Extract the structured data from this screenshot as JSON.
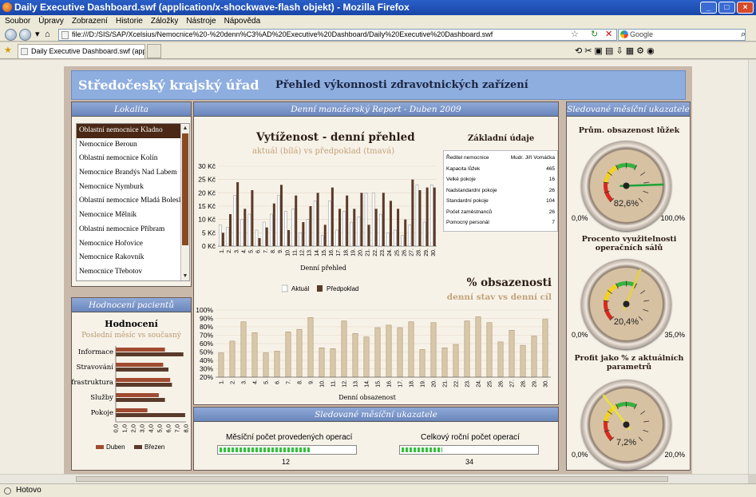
{
  "window": {
    "title": "Daily Executive Dashboard.swf (application/x-shockwave-flash objekt) - Mozilla Firefox"
  },
  "menu": [
    "Soubor",
    "Úpravy",
    "Zobrazení",
    "Historie",
    "Záložky",
    "Nástroje",
    "Nápověda"
  ],
  "browser": {
    "url": "file:///D:/SIS/SAP/Xcelsius/Nemocnice%20-%20denn%C3%AD%20Executive%20Dashboard/Daily%20Executive%20Dashboard.swf",
    "search_placeholder": "Google",
    "tab_label": "Daily Executive Dashboard.swf (applica...",
    "status": "Hotovo"
  },
  "dashboard": {
    "org_title": "Středočeský krajský úřad",
    "main_title": "Přehled výkonnosti zdravotnických zařízení",
    "location_panel_title": "Lokalita",
    "locations": [
      "Oblastní nemocnice Kladno",
      "Nemocnice Beroun",
      "Oblastní nemocnice Kolín",
      "Nemocnice Brandýs Nad Labem",
      "Nemocnice Nymburk",
      "Oblastní nemocnice Mladá Boleslav",
      "Nemocnice Mělník",
      "Oblastní nemocnice Příbram",
      "Nemocnice Hořovice",
      "Nemocnice Rakovník",
      "Nemocnice Třebotov"
    ],
    "selected_location_index": 0,
    "report_panel_title": "Denní manažerský Report - Duben 2009",
    "occupancy_title": "Vytíženost - denní přehled",
    "occupancy_subtitle": "aktuál (bílá) vs předpoklad (tmavá)",
    "basic_info_title": "Základní údaje",
    "basic_info": [
      {
        "label": "Ředitel nemocnice",
        "value": "Mudr. Jiří Vomáčka"
      },
      {
        "label": "Kapacita lůžek",
        "value": "465"
      },
      {
        "label": "Velké pokoje",
        "value": "16"
      },
      {
        "label": "Nadstandardní pokoje",
        "value": "26"
      },
      {
        "label": "Standardní pokoje",
        "value": "104"
      },
      {
        "label": "Počet zaměstnanců",
        "value": "26"
      },
      {
        "label": "Pomocný personál",
        "value": "7"
      }
    ],
    "pct_title": "% obsazenosti",
    "pct_subtitle": "denní stav vs denní cíl",
    "patients_panel_title": "Hodnocení pacientů",
    "patients_title": "Hodnocení",
    "patients_subtitle": "Poslední měsíc vs současný",
    "monthly_panel_title": "Sledované měsíční ukazatele",
    "monthly_ops_label": "Měsíční počet provedených operací",
    "monthly_ops_value": "12",
    "monthly_ops_fill": 0.68,
    "yearly_ops_label": "Celkový roční počet operací",
    "yearly_ops_value": "34",
    "yearly_ops_fill": 0.3,
    "gauges_panel_title": "Sledované měsíční ukazatele",
    "gauges": [
      {
        "title": "Prům. obsazenost lůžek",
        "value": "82,6%",
        "value_num": 82.6,
        "min": "0,0%",
        "max": "100,0%",
        "max_num": 100
      },
      {
        "title": "Procento využitelnosti operačních sálů",
        "value": "20,4%",
        "value_num": 20.4,
        "min": "0,0%",
        "max": "35,0%",
        "max_num": 35
      },
      {
        "title": "Profit jako % z aktuálních parametrů",
        "value": "7,2%",
        "value_num": 7.2,
        "min": "0,0%",
        "max": "20,0%",
        "max_num": 20
      }
    ],
    "colors": {
      "header": "#8eaee0",
      "dark_bar": "#5a3a2a",
      "light_bar": "#ffffff",
      "pct_bar": "#d8c8a8",
      "patient_recent": "#5a3a2a",
      "patient_current": "#a04a30",
      "gauge_needle_1": "#23a23a",
      "gauge_needle_2": "#e8d040",
      "gauge_needle_3": "#e8e040"
    }
  },
  "chart_data": [
    {
      "type": "bar",
      "xlabel": "Denní přehled",
      "ylabel": "",
      "categories": [
        "1",
        "2",
        "3",
        "4",
        "5",
        "6",
        "7",
        "8",
        "9",
        "10",
        "11",
        "12",
        "13",
        "14",
        "15",
        "16",
        "17",
        "18",
        "19",
        "20",
        "21",
        "22",
        "23",
        "24",
        "25",
        "26",
        "27",
        "28",
        "29",
        "30"
      ],
      "yticks": [
        "0 Kč",
        "5 Kč",
        "10 Kč",
        "15 Kč",
        "20 Kč",
        "25 Kč",
        "30 Kč"
      ],
      "ylim": [
        0,
        30
      ],
      "series": [
        {
          "name": "Aktuál",
          "values": [
            8,
            7,
            19,
            10,
            12,
            6,
            9,
            12,
            19,
            13,
            14,
            5,
            10,
            17,
            4,
            17,
            6,
            13,
            9,
            11,
            20,
            20,
            12,
            5,
            6,
            4,
            8,
            23,
            9,
            23
          ]
        },
        {
          "name": "Předpoklad",
          "values": [
            5,
            12,
            24,
            14,
            21,
            3,
            7,
            16,
            23,
            6,
            19,
            9,
            15,
            20,
            8,
            22,
            14,
            19,
            14,
            20,
            8,
            14,
            20,
            17,
            14,
            10,
            25,
            21,
            22,
            22
          ]
        }
      ]
    },
    {
      "type": "bar",
      "xlabel": "Denní obsazenost",
      "categories": [
        "1",
        "2",
        "3",
        "4",
        "5",
        "6",
        "7",
        "8",
        "9",
        "10",
        "11",
        "12",
        "13",
        "14",
        "15",
        "16",
        "17",
        "18",
        "19",
        "20",
        "21",
        "22",
        "23",
        "24",
        "25",
        "26",
        "27",
        "28",
        "29",
        "30"
      ],
      "yticks": [
        "20%",
        "30%",
        "40%",
        "50%",
        "60%",
        "70%",
        "80%",
        "90%",
        "100%"
      ],
      "ylim": [
        20,
        100
      ],
      "values": [
        49,
        63,
        86,
        73,
        49,
        51,
        74,
        77,
        91,
        55,
        54,
        87,
        72,
        68,
        79,
        82,
        79,
        86,
        53,
        85,
        55,
        59,
        87,
        92,
        85,
        62,
        76,
        58,
        69,
        89
      ]
    },
    {
      "type": "bar",
      "orientation": "horizontal",
      "categories": [
        "Informace",
        "Stravování",
        "Infrastruktura",
        "Služby",
        "Pokoje"
      ],
      "xticks": [
        "0,0",
        "1,0",
        "2,0",
        "3,0",
        "4,0",
        "5,0",
        "6,0",
        "7,0",
        "8,0"
      ],
      "xlim": [
        0,
        8
      ],
      "series": [
        {
          "name": "Duben",
          "values": [
            5.6,
            5.4,
            6.2,
            4.9,
            3.6
          ]
        },
        {
          "name": "Březen",
          "values": [
            7.7,
            6.0,
            6.4,
            5.6,
            7.9
          ]
        }
      ]
    }
  ]
}
